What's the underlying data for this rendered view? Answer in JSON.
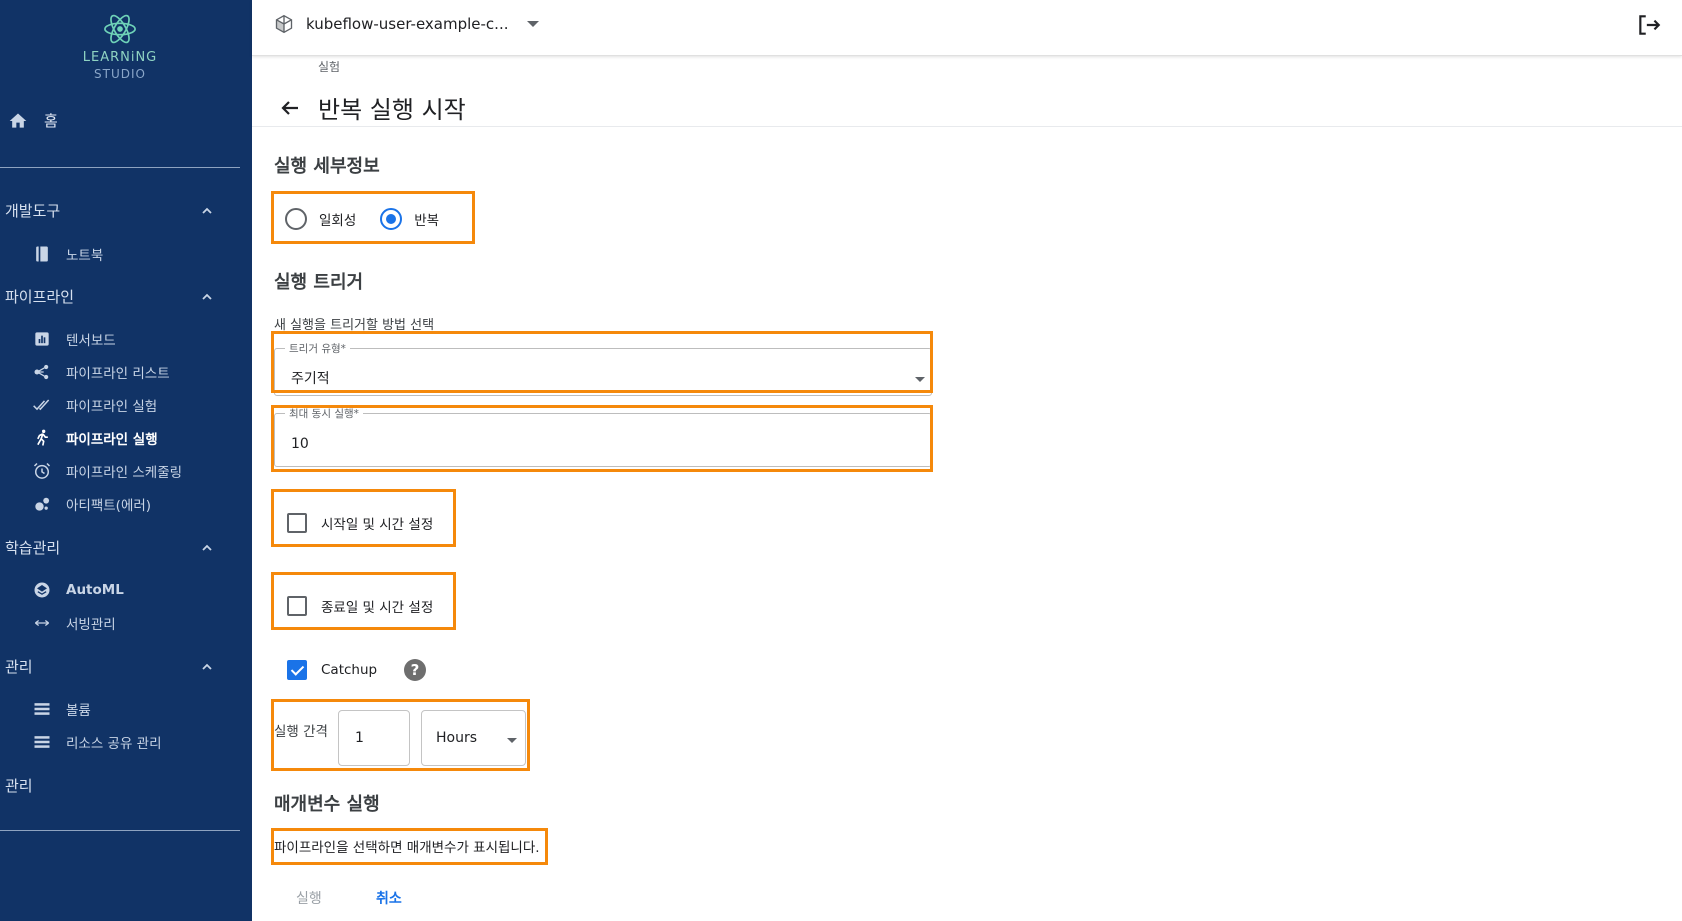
{
  "brand": {
    "line1": "LEARNiNG",
    "line2": "STUDIO"
  },
  "sidebar": {
    "home": "홈",
    "sections": [
      {
        "label": "개발도구",
        "items": [
          {
            "label": "노트북",
            "icon": "notebook-icon"
          }
        ]
      },
      {
        "label": "파이프라인",
        "items": [
          {
            "label": "텐서보드",
            "icon": "chart-icon"
          },
          {
            "label": "파이프라인 리스트",
            "icon": "pipeline-icon"
          },
          {
            "label": "파이프라인 실험",
            "icon": "double-check-icon"
          },
          {
            "label": "파이프라인 실행",
            "icon": "run-icon",
            "active": true
          },
          {
            "label": "파이프라인 스케줄링",
            "icon": "alarm-icon"
          },
          {
            "label": "아티팩트(에러)",
            "icon": "bubbles-icon"
          }
        ]
      },
      {
        "label": "학습관리",
        "items": [
          {
            "label": "AutoML",
            "icon": "automl-icon"
          },
          {
            "label": "서빙관리",
            "icon": "arrows-icon"
          }
        ]
      },
      {
        "label": "관리",
        "items": [
          {
            "label": "볼륨",
            "icon": "list-icon"
          },
          {
            "label": "리소스 공유 관리",
            "icon": "list-icon"
          }
        ]
      },
      {
        "label": "관리",
        "items": []
      }
    ]
  },
  "topbar": {
    "namespace": "kubeflow-user-example-c..."
  },
  "page": {
    "breadcrumb": "실험",
    "title": "반복 실행 시작",
    "run_details_heading": "실행 세부정보",
    "run_type": {
      "options": [
        "일회성",
        "반복"
      ],
      "selected": "반복"
    },
    "trigger_heading": "실행 트리거",
    "trigger_subtext": "새 실행을 트리거할 방법 선택",
    "trigger_type": {
      "label": "트리거 유형*",
      "value": "주기적"
    },
    "max_concurrent": {
      "label": "최대 동시 실행*",
      "value": "10"
    },
    "start_checkbox": {
      "label": "시작일 및 시간 설정",
      "checked": false
    },
    "end_checkbox": {
      "label": "종료일 및 시간 설정",
      "checked": false
    },
    "catchup": {
      "label": "Catchup",
      "checked": true,
      "help": "?"
    },
    "interval": {
      "label": "실행 간격",
      "value": "1",
      "unit": "Hours"
    },
    "params_heading": "매개변수 실행",
    "params_message": "파이프라인을 선택하면 매개변수가 표시됩니다.",
    "buttons": {
      "run": "실행",
      "cancel": "취소"
    }
  },
  "colors": {
    "sidebar_bg": "#113366",
    "highlight": "#f5890b",
    "accent": "#1a73e8"
  }
}
